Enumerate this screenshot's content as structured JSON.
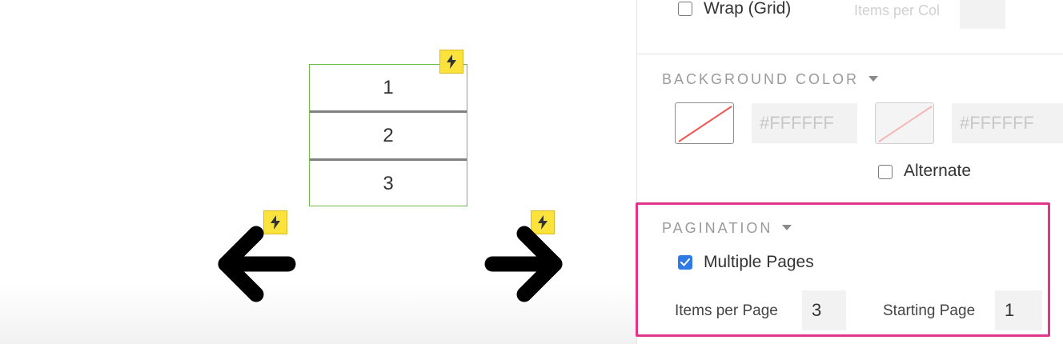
{
  "canvas": {
    "repeater_items": [
      "1",
      "2",
      "3"
    ],
    "icons": {
      "interaction_badge": "lightning-bolt-icon",
      "prev_arrow": "arrow-left-icon",
      "next_arrow": "arrow-right-icon"
    },
    "colors": {
      "badge": "#fbe33c",
      "repeater_border": "#6cbd45",
      "divider": "#808080"
    }
  },
  "panel": {
    "layout": {
      "wrap_label": "Wrap (Grid)",
      "wrap_checked": false,
      "items_per_col_label": "Items per Col",
      "items_per_col_value": ""
    },
    "background_color": {
      "title": "BACKGROUND COLOR",
      "primary_hex": "#FFFFFF",
      "alternate_hex": "#FFFFFF",
      "alternate_label": "Alternate",
      "alternate_checked": false
    },
    "pagination": {
      "title": "PAGINATION",
      "multiple_pages_label": "Multiple Pages",
      "multiple_pages_checked": true,
      "items_per_page_label": "Items per Page",
      "items_per_page_value": "3",
      "starting_page_label": "Starting Page",
      "starting_page_value": "1",
      "highlight_color": "#e0358a"
    }
  }
}
